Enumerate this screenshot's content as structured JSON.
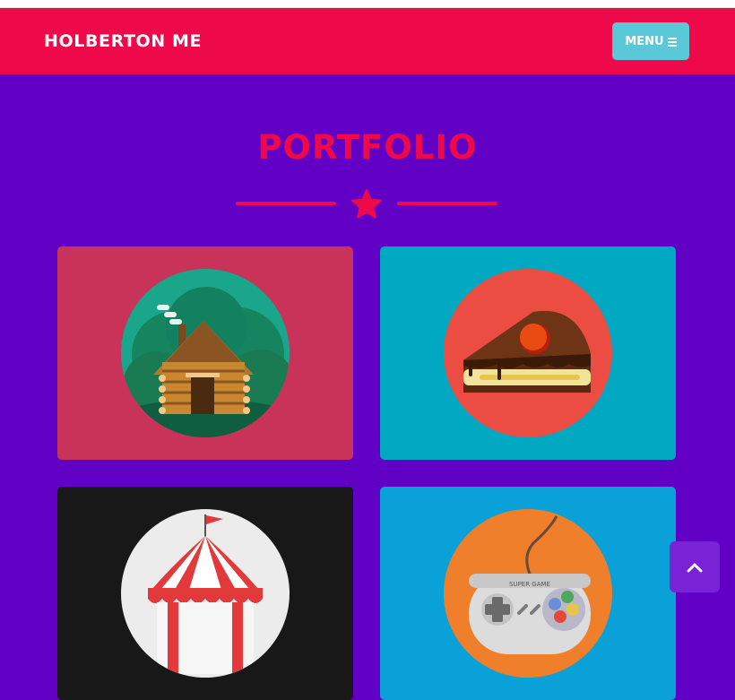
{
  "nav": {
    "brand": "HOLBERTON ME",
    "menu_label": "MENU",
    "menu_icon": "bars-icon"
  },
  "portfolio": {
    "title": "PORTFOLIO",
    "divider_icon": "star-icon",
    "items": [
      {
        "name": "cabin",
        "icon": "log-cabin-icon",
        "background": "#c9335a",
        "circle": "#1aa68a"
      },
      {
        "name": "cake",
        "icon": "cake-slice-icon",
        "background": "#00a8c2",
        "circle": "#ec4d43"
      },
      {
        "name": "circus",
        "icon": "circus-tent-icon",
        "background": "#181818",
        "circle": "#ececec"
      },
      {
        "name": "game",
        "icon": "game-controller-icon",
        "background": "#0aa0d8",
        "circle": "#f07f2c"
      }
    ]
  },
  "back_to_top": {
    "icon": "chevron-up-icon"
  },
  "colors": {
    "background": "#6100c4",
    "accent": "#ee0a4a",
    "menu_button": "#5bc8d8"
  }
}
